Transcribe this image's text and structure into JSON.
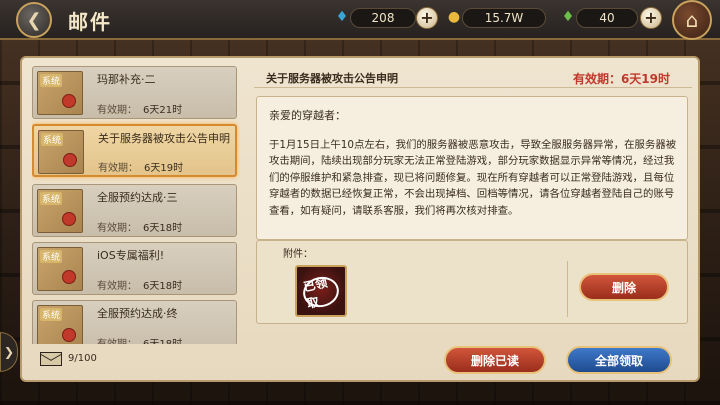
{
  "header": {
    "title": "邮件",
    "resources": [
      {
        "icon": "fish-icon",
        "value": "208"
      },
      {
        "icon": "coin-icon",
        "value": "15.7W"
      },
      {
        "icon": "gem-icon",
        "value": "40"
      }
    ]
  },
  "mail_list": [
    {
      "tag": "系统",
      "title": "玛那补充·二",
      "exp_label": "有效期：",
      "exp_value": "6天21时"
    },
    {
      "tag": "系统",
      "title": "关于服务器被攻击公告申明",
      "exp_label": "有效期：",
      "exp_value": "6天19时"
    },
    {
      "tag": "系统",
      "title": "全服预约达成·三",
      "exp_label": "有效期：",
      "exp_value": "6天18时"
    },
    {
      "tag": "系统",
      "title": "iOS专属福利!",
      "exp_label": "有效期：",
      "exp_value": "6天18时"
    },
    {
      "tag": "系统",
      "title": "全服预约达成·终",
      "exp_label": "有效期：",
      "exp_value": "6天18时"
    }
  ],
  "detail": {
    "title": "关于服务器被攻击公告申明",
    "expiry": "有效期：6天19时",
    "greeting": "亲爱的穿越者：",
    "body": "于1月15日上午10点左右，我们的服务器被恶意攻击，导致全服服务器异常，在服务器被攻击期间，陆续出现部分玩家无法正常登陆游戏，部分玩家数据显示异常等情况，经过我们的停服维护和紧急排查，现已将问题修复。现在所有穿越者可以正常登陆游戏，且每位穿越者的数据已经恢复正常，不会出现掉档、回档等情况，请各位穿越者登陆自己的账号查看，如有疑问，请联系客服，我们将再次核对排查。",
    "attachment_label": "附件：",
    "claimed_stamp": "已领取",
    "delete_label": "删除"
  },
  "footer": {
    "mail_count": "9/100",
    "delete_read_label": "删除已读",
    "claim_all_label": "全部领取"
  }
}
